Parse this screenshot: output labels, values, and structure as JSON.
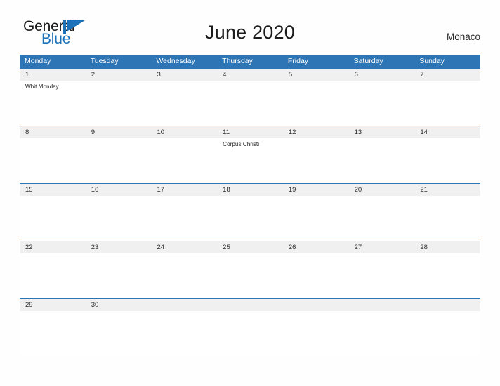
{
  "logo": {
    "word1": "General",
    "word2": "Blue",
    "flag_icon": "blue-pennant-icon",
    "color_text": "#1a1a1a",
    "color_blue": "#1b72b8"
  },
  "header": {
    "title": "June 2020",
    "country": "Monaco"
  },
  "colors": {
    "header_blue": "#2e75b6",
    "date_band_gray": "#f0f0f0",
    "page_background": "#ffffff",
    "text_dark": "#2d2d2d"
  },
  "calendar": {
    "day_names": [
      "Monday",
      "Tuesday",
      "Wednesday",
      "Thursday",
      "Friday",
      "Saturday",
      "Sunday"
    ],
    "weeks": [
      {
        "days": [
          {
            "date": "1",
            "event": "Whit Monday"
          },
          {
            "date": "2",
            "event": ""
          },
          {
            "date": "3",
            "event": ""
          },
          {
            "date": "4",
            "event": ""
          },
          {
            "date": "5",
            "event": ""
          },
          {
            "date": "6",
            "event": ""
          },
          {
            "date": "7",
            "event": ""
          }
        ]
      },
      {
        "days": [
          {
            "date": "8",
            "event": ""
          },
          {
            "date": "9",
            "event": ""
          },
          {
            "date": "10",
            "event": ""
          },
          {
            "date": "11",
            "event": "Corpus Christi"
          },
          {
            "date": "12",
            "event": ""
          },
          {
            "date": "13",
            "event": ""
          },
          {
            "date": "14",
            "event": ""
          }
        ]
      },
      {
        "days": [
          {
            "date": "15",
            "event": ""
          },
          {
            "date": "16",
            "event": ""
          },
          {
            "date": "17",
            "event": ""
          },
          {
            "date": "18",
            "event": ""
          },
          {
            "date": "19",
            "event": ""
          },
          {
            "date": "20",
            "event": ""
          },
          {
            "date": "21",
            "event": ""
          }
        ]
      },
      {
        "days": [
          {
            "date": "22",
            "event": ""
          },
          {
            "date": "23",
            "event": ""
          },
          {
            "date": "24",
            "event": ""
          },
          {
            "date": "25",
            "event": ""
          },
          {
            "date": "26",
            "event": ""
          },
          {
            "date": "27",
            "event": ""
          },
          {
            "date": "28",
            "event": ""
          }
        ]
      },
      {
        "days": [
          {
            "date": "29",
            "event": ""
          },
          {
            "date": "30",
            "event": ""
          },
          {
            "date": "",
            "event": ""
          },
          {
            "date": "",
            "event": ""
          },
          {
            "date": "",
            "event": ""
          },
          {
            "date": "",
            "event": ""
          },
          {
            "date": "",
            "event": ""
          }
        ]
      }
    ]
  }
}
